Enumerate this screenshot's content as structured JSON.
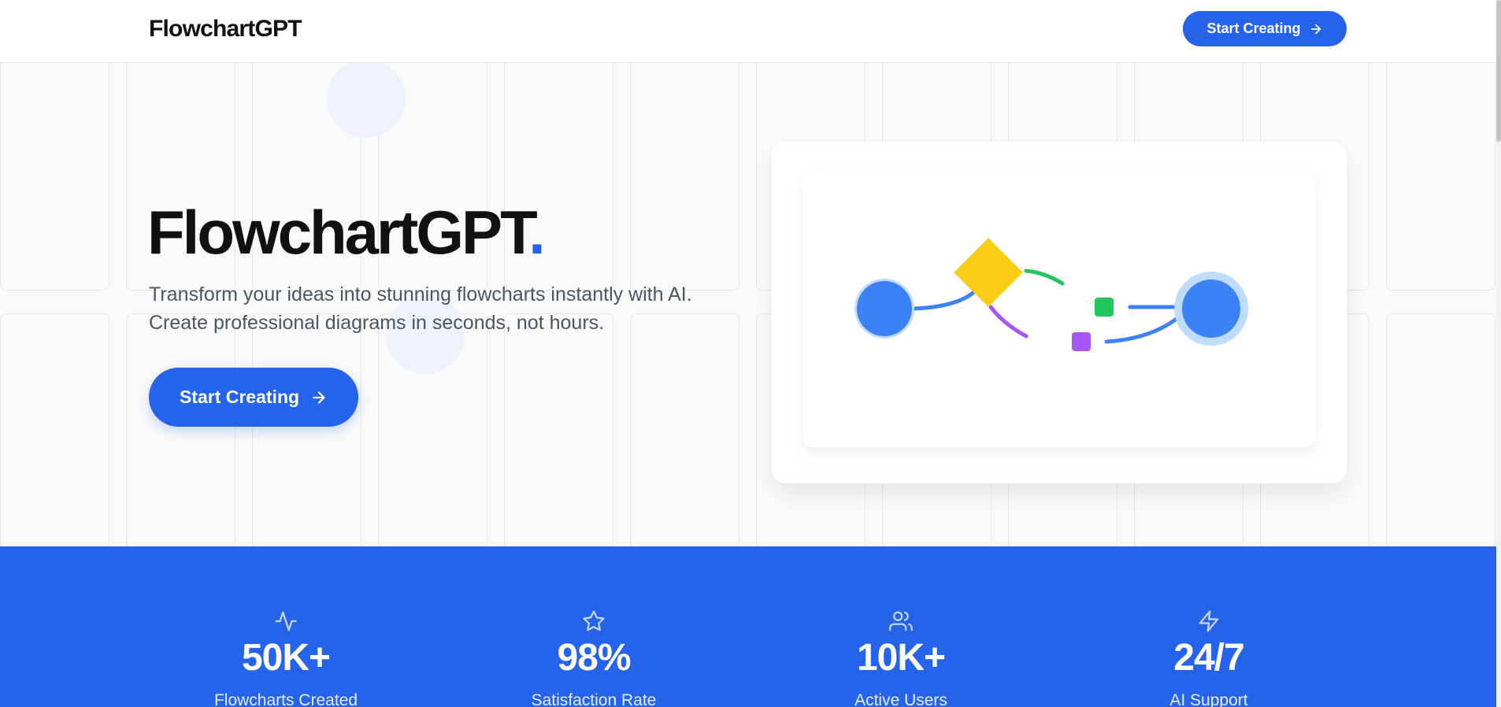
{
  "header": {
    "brand": "FlowchartGPT",
    "cta_label": "Start Creating"
  },
  "hero": {
    "title": "FlowchartGPT",
    "title_dot": ".",
    "subtitle_line1": "Transform your ideas into stunning flowcharts instantly with AI.",
    "subtitle_line2": "Create professional diagrams in seconds, not hours.",
    "cta_label": "Start Creating"
  },
  "illustration": {
    "icons": [
      "start-node-circle",
      "decision-diamond",
      "green-square",
      "purple-square",
      "end-node-circle"
    ],
    "colors": {
      "blue": "#3b82f6",
      "yellow": "#facc15",
      "green": "#22c55e",
      "purple": "#a855f7",
      "blue_halo": "#bfdbfe"
    }
  },
  "stats": [
    {
      "icon": "activity-icon",
      "value": "50K+",
      "label": "Flowcharts Created"
    },
    {
      "icon": "star-icon",
      "value": "98%",
      "label": "Satisfaction Rate"
    },
    {
      "icon": "users-icon",
      "value": "10K+",
      "label": "Active Users"
    },
    {
      "icon": "lightning-icon",
      "value": "24/7",
      "label": "AI Support"
    }
  ],
  "theme": {
    "primary": "#2563eb",
    "text_dark": "#111111",
    "text_muted": "#4b5563"
  }
}
